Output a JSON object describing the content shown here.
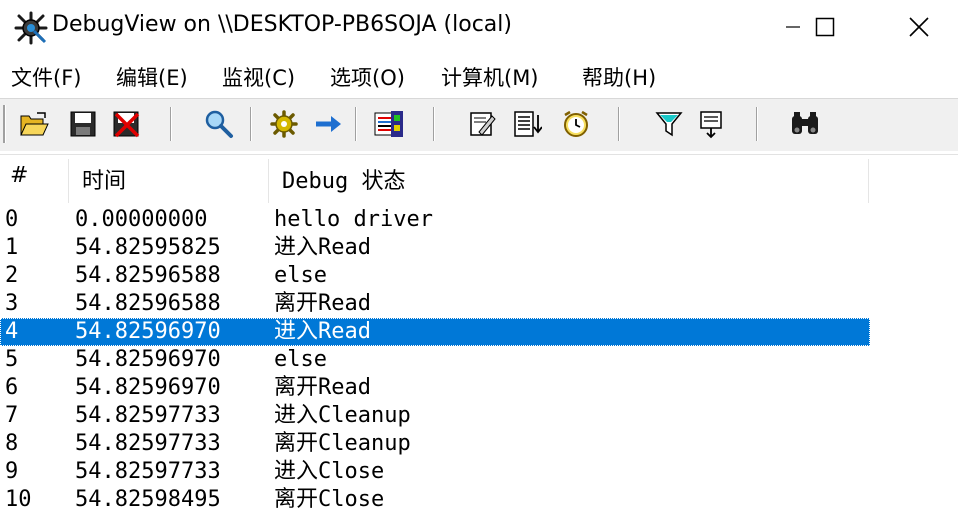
{
  "window": {
    "title": "DebugView on \\\\DESKTOP-PB6SOJA (local)",
    "icon": "debugview-gear-icon"
  },
  "menu": [
    {
      "label": "文件(F)"
    },
    {
      "label": "编辑(E)"
    },
    {
      "label": "监视(C)"
    },
    {
      "label": "选项(O)"
    },
    {
      "label": "计算机(M)"
    },
    {
      "label": "帮助(H)"
    }
  ],
  "toolbar": {
    "icons": [
      "open-folder-icon",
      "save-icon",
      "clear-display-icon",
      "find-icon",
      "capture-icon",
      "autoscroll-arrow-icon",
      "history-depth-icon",
      "highlight-icon",
      "filter-icon",
      "clock-time-icon",
      "filter-funnel-icon",
      "memo-icon",
      "find-binoculars-icon"
    ]
  },
  "columns": [
    {
      "label": "#"
    },
    {
      "label": "时间"
    },
    {
      "label": "Debug 状态"
    }
  ],
  "rows": [
    {
      "num": "0",
      "time": "0.00000000",
      "msg": "hello driver"
    },
    {
      "num": "1",
      "time": "54.82595825",
      "msg": "进入Read"
    },
    {
      "num": "2",
      "time": "54.82596588",
      "msg": "else"
    },
    {
      "num": "3",
      "time": "54.82596588",
      "msg": "离开Read"
    },
    {
      "num": "4",
      "time": "54.82596970",
      "msg": "进入Read"
    },
    {
      "num": "5",
      "time": "54.82596970",
      "msg": "else"
    },
    {
      "num": "6",
      "time": "54.82596970",
      "msg": "离开Read"
    },
    {
      "num": "7",
      "time": "54.82597733",
      "msg": "进入Cleanup"
    },
    {
      "num": "8",
      "time": "54.82597733",
      "msg": "离开Cleanup"
    },
    {
      "num": "9",
      "time": "54.82597733",
      "msg": "进入Close"
    },
    {
      "num": "10",
      "time": "54.82598495",
      "msg": "离开Close"
    }
  ],
  "selected_row": "4",
  "colors": {
    "selection": "#0078d7",
    "toolbar_bg": "#f0f0f0"
  }
}
